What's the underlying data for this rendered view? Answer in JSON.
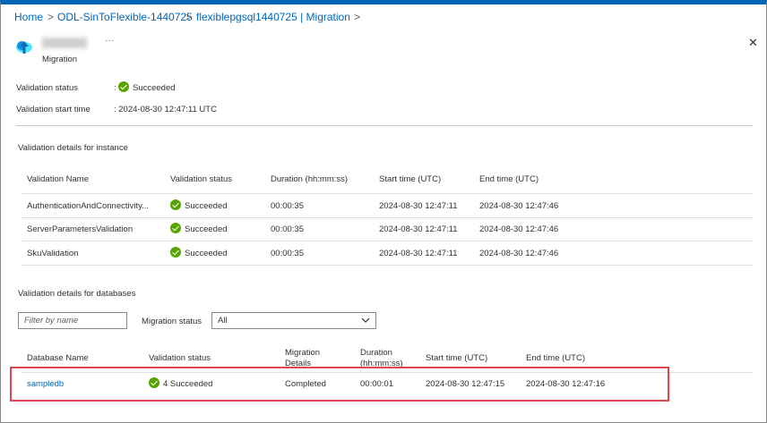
{
  "breadcrumb": {
    "items": [
      "Home",
      "ODL-SinToFlexible-1440725",
      "flexiblepgsql1440725 | Migration"
    ],
    "separator": ">"
  },
  "header": {
    "subtitle": "Migration",
    "more": "···",
    "close": "✕"
  },
  "summary": {
    "status_label": "Validation status",
    "status_colon": ":",
    "status_value": "Succeeded",
    "start_label": "Validation start time",
    "start_value": ": 2024-08-30 12:47:11 UTC"
  },
  "instance": {
    "section_title": "Validation details for instance",
    "columns": [
      "Validation Name",
      "Validation status",
      "Duration (hh:mm:ss)",
      "Start time (UTC)",
      "End time (UTC)"
    ],
    "rows": [
      {
        "name": "AuthenticationAndConnectivity...",
        "status": "Succeeded",
        "duration": "00:00:35",
        "start": "2024-08-30 12:47:11",
        "end": "2024-08-30 12:47:46"
      },
      {
        "name": "ServerParametersValidation",
        "status": "Succeeded",
        "duration": "00:00:35",
        "start": "2024-08-30 12:47:11",
        "end": "2024-08-30 12:47:46"
      },
      {
        "name": "SkuValidation",
        "status": "Succeeded",
        "duration": "00:00:35",
        "start": "2024-08-30 12:47:11",
        "end": "2024-08-30 12:47:46"
      }
    ]
  },
  "databases": {
    "section_title": "Validation details for databases",
    "filter_placeholder": "Filter by name",
    "migration_status_label": "Migration status",
    "migration_status_value": "All",
    "columns": {
      "name": "Database Name",
      "validation": "Validation status",
      "migration_line1": "Migration",
      "migration_line2": "Details",
      "duration_line1": "Duration",
      "duration_line2": "(hh:mm:ss)",
      "start": "Start time (UTC)",
      "end": "End time (UTC)"
    },
    "rows": [
      {
        "name": "sampledb",
        "validation": "4 Succeeded",
        "migration": "Completed",
        "duration": "00:00:01",
        "start": "2024-08-30 12:47:15",
        "end": "2024-08-30 12:47:16"
      }
    ]
  },
  "colors": {
    "accent": "#0067b8",
    "success": "#57a300",
    "highlight": "#e0474c"
  }
}
